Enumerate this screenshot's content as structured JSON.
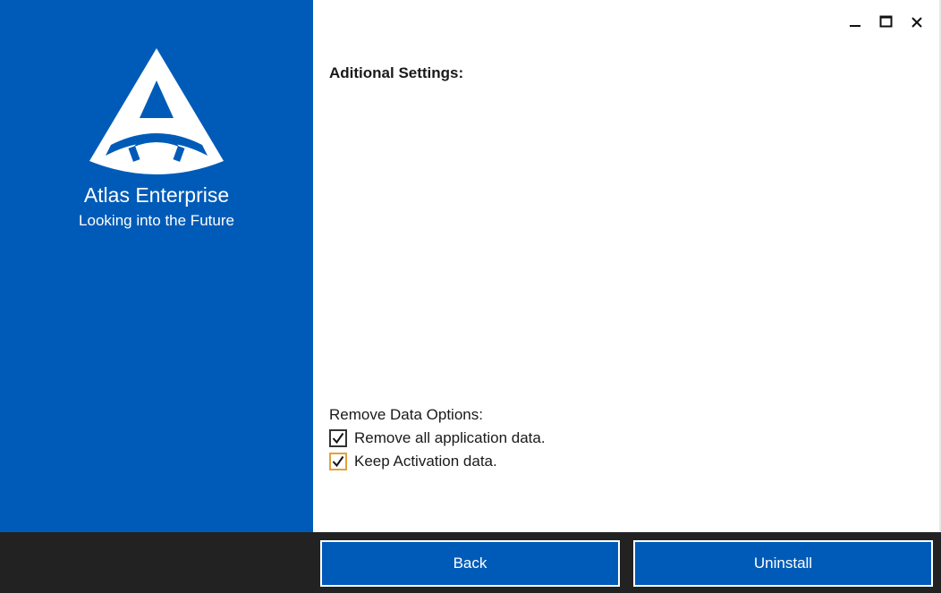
{
  "app": {
    "name": "Atlas Enterprise",
    "tagline": "Looking into the Future"
  },
  "window_controls": {
    "minimize_icon": "minimize-icon",
    "maximize_icon": "maximize-icon",
    "close_icon": "close-icon"
  },
  "main": {
    "section_title": "Aditional Settings:",
    "remove_data": {
      "title": "Remove Data Options:",
      "options": [
        {
          "label": "Remove all application data.",
          "checked": true,
          "focused": false
        },
        {
          "label": "Keep Activation data.",
          "checked": true,
          "focused": true
        }
      ]
    }
  },
  "footer": {
    "back_label": "Back",
    "uninstall_label": "Uninstall"
  },
  "colors": {
    "accent": "#005bb8",
    "footer": "#222222",
    "focus": "#e2a13a"
  }
}
